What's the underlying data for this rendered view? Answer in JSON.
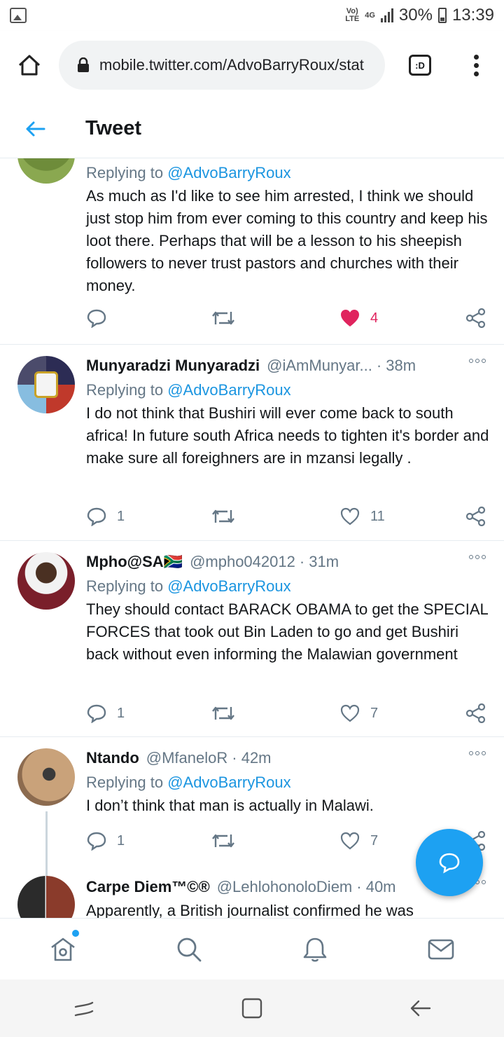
{
  "status_bar": {
    "network_label_top": "Vo)",
    "network_label_bottom": "LTE",
    "data_type": "4G",
    "battery": "30%",
    "time": "13:39"
  },
  "browser": {
    "url": "mobile.twitter.com/AdvoBarryRoux/stat",
    "tabs_label": ":D"
  },
  "header": {
    "title": "Tweet"
  },
  "tweets": [
    {
      "name": "",
      "handle": "",
      "time": "",
      "replying_prefix": "Replying to ",
      "replying_to": "@AdvoBarryRoux",
      "text": "As much as I'd like to see him arrested, I think we should just stop him from ever coming to this country and keep his loot there. Perhaps that will be a lesson to his sheepish followers to never trust pastors and churches with their money.",
      "replies": "",
      "retweets": "",
      "likes": "4",
      "liked": true
    },
    {
      "name": "Munyaradzi Munyaradzi",
      "handle": "@iAmMunyar...",
      "time": "· 38m",
      "replying_prefix": "Replying to ",
      "replying_to": "@AdvoBarryRoux",
      "text": "I do not think that Bushiri will ever come back to south africa! In future south Africa needs to tighten it's border and make sure all foreighners are in mzansi legally .",
      "replies": "1",
      "retweets": "",
      "likes": "11",
      "liked": false
    },
    {
      "name": "Mpho@SA🇿🇦",
      "handle": "@mpho042012",
      "time": "· 31m",
      "replying_prefix": "Replying to ",
      "replying_to": "@AdvoBarryRoux",
      "text": "They should contact BARACK OBAMA to get the SPECIAL FORCES that took out Bin Laden to go and get Bushiri back without even informing the Malawian government",
      "replies": "1",
      "retweets": "",
      "likes": "7",
      "liked": false
    },
    {
      "name": "Ntando",
      "handle": "@MfaneloR",
      "time": "· 42m",
      "replying_prefix": "Replying to ",
      "replying_to": "@AdvoBarryRoux",
      "text": "I don’t think that man is actually in Malawi.",
      "replies": "1",
      "retweets": "",
      "likes": "7",
      "liked": false
    },
    {
      "name": "Carpe Diem™©®",
      "handle": "@LehlohonoloDiem",
      "time": "· 40m",
      "replying_prefix": "",
      "replying_to": "",
      "text": "Apparently, a British journalist confirmed he was",
      "replies": "",
      "retweets": "",
      "likes": "",
      "liked": false
    }
  ],
  "colors": {
    "accent": "#1da1f2",
    "link": "#1b95e0",
    "like": "#e0245e",
    "secondary_text": "#657786"
  },
  "icons": {
    "home": "home-icon",
    "search": "search-icon",
    "notifications": "bell-icon",
    "messages": "mail-icon",
    "compose": "compose-bubble-icon"
  }
}
